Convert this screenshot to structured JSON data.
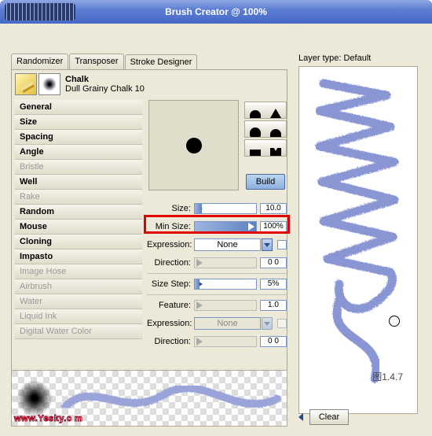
{
  "window": {
    "title": "Brush Creator @ 100%"
  },
  "tabs": {
    "randomizer": "Randomizer",
    "transposer": "Transposer",
    "stroke_designer": "Stroke Designer"
  },
  "brush": {
    "name": "Chalk",
    "variant": "Dull Grainy Chalk 10"
  },
  "categories": [
    {
      "label": "General",
      "bold": true,
      "dim": false
    },
    {
      "label": "Size",
      "bold": true,
      "dim": false
    },
    {
      "label": "Spacing",
      "bold": true,
      "dim": false
    },
    {
      "label": "Angle",
      "bold": true,
      "dim": false
    },
    {
      "label": "Bristle",
      "bold": false,
      "dim": true
    },
    {
      "label": "Well",
      "bold": true,
      "dim": false
    },
    {
      "label": "Rake",
      "bold": false,
      "dim": true
    },
    {
      "label": "Random",
      "bold": true,
      "dim": false
    },
    {
      "label": "Mouse",
      "bold": true,
      "dim": false
    },
    {
      "label": "Cloning",
      "bold": true,
      "dim": false
    },
    {
      "label": "Impasto",
      "bold": true,
      "dim": false
    },
    {
      "label": "Image Hose",
      "bold": false,
      "dim": true
    },
    {
      "label": "Airbrush",
      "bold": false,
      "dim": true
    },
    {
      "label": "Water",
      "bold": false,
      "dim": true
    },
    {
      "label": "Liquid Ink",
      "bold": false,
      "dim": true
    },
    {
      "label": "Digital Water Color",
      "bold": false,
      "dim": true
    }
  ],
  "build_label": "Build",
  "controls": {
    "size": {
      "label": "Size:",
      "value": "10.0"
    },
    "min_size": {
      "label": "Min Size:",
      "value": "100%"
    },
    "expression1": {
      "label": "Expression:",
      "value": "None"
    },
    "direction1": {
      "label": "Direction:",
      "value": "0 0"
    },
    "size_step": {
      "label": "Size Step:",
      "value": "5%"
    },
    "feature": {
      "label": "Feature:",
      "value": "1.0"
    },
    "expression2": {
      "label": "Expression:",
      "value": "None"
    },
    "direction2": {
      "label": "Direction:",
      "value": "0 0"
    }
  },
  "right": {
    "layer_type": "Layer type: Default",
    "figure_label": "图1.4.7",
    "clear": "Clear"
  },
  "watermark": "www.Yesky.c    m"
}
